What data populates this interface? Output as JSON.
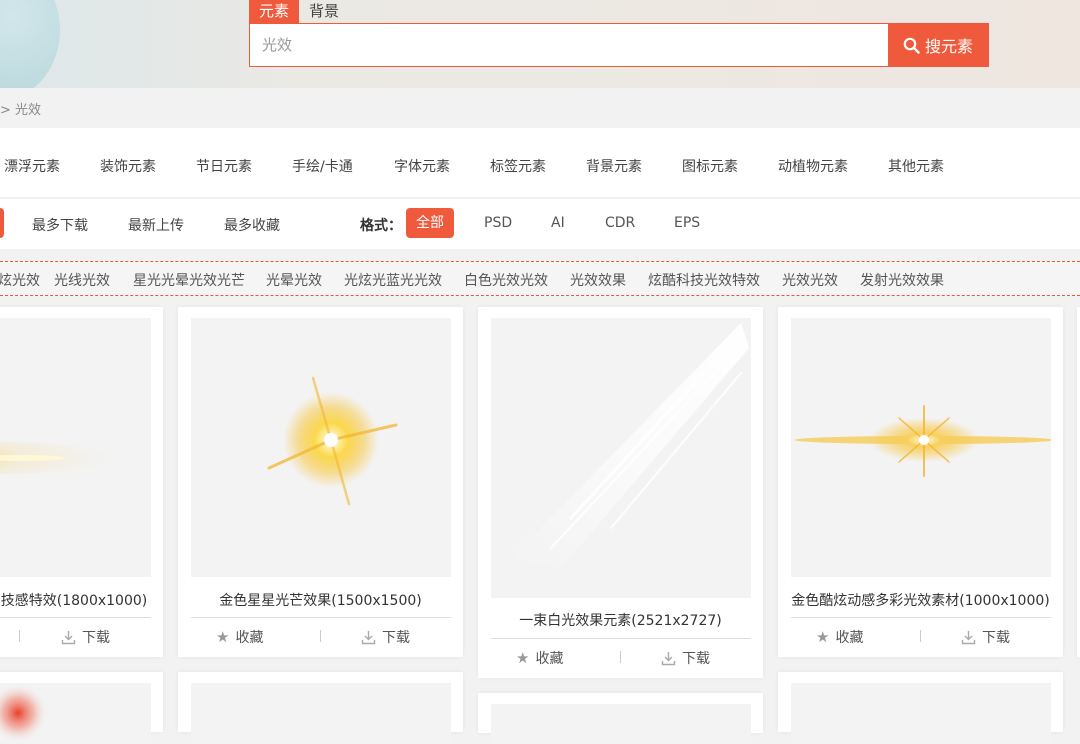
{
  "search": {
    "tabs": [
      "元素",
      "背景"
    ],
    "placeholder": "光效",
    "button_label": "搜元素"
  },
  "breadcrumb": "> 光效",
  "categories": [
    "漂浮元素",
    "装饰元素",
    "节日元素",
    "手绘/卡通",
    "字体元素",
    "标签元素",
    "背景元素",
    "图标元素",
    "动植物元素",
    "其他元素"
  ],
  "sort": [
    "最多下载",
    "最新上传",
    "最多收藏"
  ],
  "format": {
    "label": "格式：",
    "options": [
      "全部",
      "PSD",
      "AI",
      "CDR",
      "EPS"
    ]
  },
  "tags": [
    "炫光效",
    "光线光效",
    "星光光晕光效光芒",
    "光晕光效",
    "光炫光蓝光光效",
    "白色光效光效",
    "光效效果",
    "炫酷科技光效特效",
    "光效光效",
    "发射光效效果"
  ],
  "cards": [
    {
      "title": "技感特效(1800x1000)",
      "download": "下载"
    },
    {
      "title": "金色星星光芒效果(1500x1500)",
      "favorite": "收藏",
      "download": "下载"
    },
    {
      "title": "一束白光效果元素(2521x2727)",
      "favorite": "收藏",
      "download": "下载"
    },
    {
      "title": "金色酷炫动感多彩光效素材(1000x1000)",
      "favorite": "收藏",
      "download": "下载"
    }
  ],
  "icons": {
    "search": "search-icon",
    "favorite": "star-icon",
    "download": "download-icon"
  },
  "colors": {
    "accent": "#f05a3c",
    "gold": "#f5c542"
  }
}
